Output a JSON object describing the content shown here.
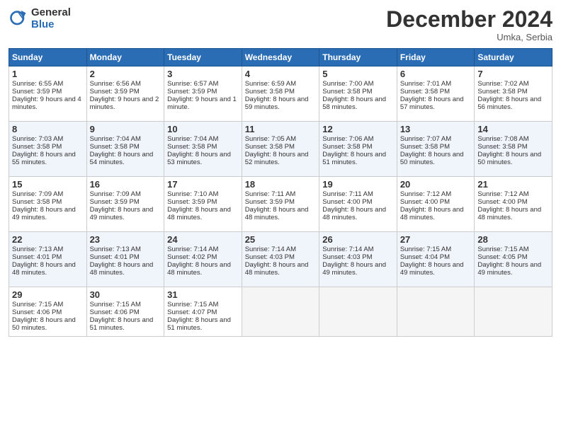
{
  "header": {
    "logo_general": "General",
    "logo_blue": "Blue",
    "title": "December 2024",
    "location": "Umka, Serbia"
  },
  "days_of_week": [
    "Sunday",
    "Monday",
    "Tuesday",
    "Wednesday",
    "Thursday",
    "Friday",
    "Saturday"
  ],
  "weeks": [
    [
      {
        "day": "1",
        "sunrise": "Sunrise: 6:55 AM",
        "sunset": "Sunset: 3:59 PM",
        "daylight": "Daylight: 9 hours and 4 minutes."
      },
      {
        "day": "2",
        "sunrise": "Sunrise: 6:56 AM",
        "sunset": "Sunset: 3:59 PM",
        "daylight": "Daylight: 9 hours and 2 minutes."
      },
      {
        "day": "3",
        "sunrise": "Sunrise: 6:57 AM",
        "sunset": "Sunset: 3:59 PM",
        "daylight": "Daylight: 9 hours and 1 minute."
      },
      {
        "day": "4",
        "sunrise": "Sunrise: 6:59 AM",
        "sunset": "Sunset: 3:58 PM",
        "daylight": "Daylight: 8 hours and 59 minutes."
      },
      {
        "day": "5",
        "sunrise": "Sunrise: 7:00 AM",
        "sunset": "Sunset: 3:58 PM",
        "daylight": "Daylight: 8 hours and 58 minutes."
      },
      {
        "day": "6",
        "sunrise": "Sunrise: 7:01 AM",
        "sunset": "Sunset: 3:58 PM",
        "daylight": "Daylight: 8 hours and 57 minutes."
      },
      {
        "day": "7",
        "sunrise": "Sunrise: 7:02 AM",
        "sunset": "Sunset: 3:58 PM",
        "daylight": "Daylight: 8 hours and 56 minutes."
      }
    ],
    [
      {
        "day": "8",
        "sunrise": "Sunrise: 7:03 AM",
        "sunset": "Sunset: 3:58 PM",
        "daylight": "Daylight: 8 hours and 55 minutes."
      },
      {
        "day": "9",
        "sunrise": "Sunrise: 7:04 AM",
        "sunset": "Sunset: 3:58 PM",
        "daylight": "Daylight: 8 hours and 54 minutes."
      },
      {
        "day": "10",
        "sunrise": "Sunrise: 7:04 AM",
        "sunset": "Sunset: 3:58 PM",
        "daylight": "Daylight: 8 hours and 53 minutes."
      },
      {
        "day": "11",
        "sunrise": "Sunrise: 7:05 AM",
        "sunset": "Sunset: 3:58 PM",
        "daylight": "Daylight: 8 hours and 52 minutes."
      },
      {
        "day": "12",
        "sunrise": "Sunrise: 7:06 AM",
        "sunset": "Sunset: 3:58 PM",
        "daylight": "Daylight: 8 hours and 51 minutes."
      },
      {
        "day": "13",
        "sunrise": "Sunrise: 7:07 AM",
        "sunset": "Sunset: 3:58 PM",
        "daylight": "Daylight: 8 hours and 50 minutes."
      },
      {
        "day": "14",
        "sunrise": "Sunrise: 7:08 AM",
        "sunset": "Sunset: 3:58 PM",
        "daylight": "Daylight: 8 hours and 50 minutes."
      }
    ],
    [
      {
        "day": "15",
        "sunrise": "Sunrise: 7:09 AM",
        "sunset": "Sunset: 3:58 PM",
        "daylight": "Daylight: 8 hours and 49 minutes."
      },
      {
        "day": "16",
        "sunrise": "Sunrise: 7:09 AM",
        "sunset": "Sunset: 3:59 PM",
        "daylight": "Daylight: 8 hours and 49 minutes."
      },
      {
        "day": "17",
        "sunrise": "Sunrise: 7:10 AM",
        "sunset": "Sunset: 3:59 PM",
        "daylight": "Daylight: 8 hours and 48 minutes."
      },
      {
        "day": "18",
        "sunrise": "Sunrise: 7:11 AM",
        "sunset": "Sunset: 3:59 PM",
        "daylight": "Daylight: 8 hours and 48 minutes."
      },
      {
        "day": "19",
        "sunrise": "Sunrise: 7:11 AM",
        "sunset": "Sunset: 4:00 PM",
        "daylight": "Daylight: 8 hours and 48 minutes."
      },
      {
        "day": "20",
        "sunrise": "Sunrise: 7:12 AM",
        "sunset": "Sunset: 4:00 PM",
        "daylight": "Daylight: 8 hours and 48 minutes."
      },
      {
        "day": "21",
        "sunrise": "Sunrise: 7:12 AM",
        "sunset": "Sunset: 4:00 PM",
        "daylight": "Daylight: 8 hours and 48 minutes."
      }
    ],
    [
      {
        "day": "22",
        "sunrise": "Sunrise: 7:13 AM",
        "sunset": "Sunset: 4:01 PM",
        "daylight": "Daylight: 8 hours and 48 minutes."
      },
      {
        "day": "23",
        "sunrise": "Sunrise: 7:13 AM",
        "sunset": "Sunset: 4:01 PM",
        "daylight": "Daylight: 8 hours and 48 minutes."
      },
      {
        "day": "24",
        "sunrise": "Sunrise: 7:14 AM",
        "sunset": "Sunset: 4:02 PM",
        "daylight": "Daylight: 8 hours and 48 minutes."
      },
      {
        "day": "25",
        "sunrise": "Sunrise: 7:14 AM",
        "sunset": "Sunset: 4:03 PM",
        "daylight": "Daylight: 8 hours and 48 minutes."
      },
      {
        "day": "26",
        "sunrise": "Sunrise: 7:14 AM",
        "sunset": "Sunset: 4:03 PM",
        "daylight": "Daylight: 8 hours and 49 minutes."
      },
      {
        "day": "27",
        "sunrise": "Sunrise: 7:15 AM",
        "sunset": "Sunset: 4:04 PM",
        "daylight": "Daylight: 8 hours and 49 minutes."
      },
      {
        "day": "28",
        "sunrise": "Sunrise: 7:15 AM",
        "sunset": "Sunset: 4:05 PM",
        "daylight": "Daylight: 8 hours and 49 minutes."
      }
    ],
    [
      {
        "day": "29",
        "sunrise": "Sunrise: 7:15 AM",
        "sunset": "Sunset: 4:06 PM",
        "daylight": "Daylight: 8 hours and 50 minutes."
      },
      {
        "day": "30",
        "sunrise": "Sunrise: 7:15 AM",
        "sunset": "Sunset: 4:06 PM",
        "daylight": "Daylight: 8 hours and 51 minutes."
      },
      {
        "day": "31",
        "sunrise": "Sunrise: 7:15 AM",
        "sunset": "Sunset: 4:07 PM",
        "daylight": "Daylight: 8 hours and 51 minutes."
      },
      null,
      null,
      null,
      null
    ]
  ]
}
